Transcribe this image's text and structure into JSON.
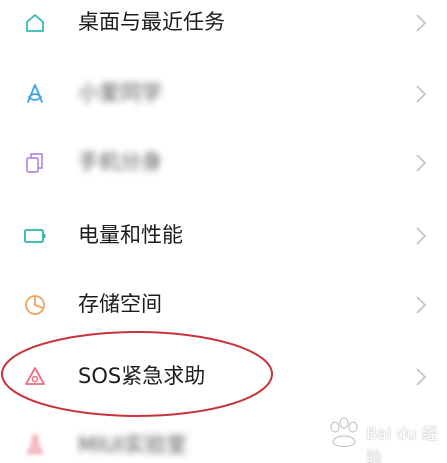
{
  "settings_list": {
    "items": [
      {
        "label": "桌面与最近任务",
        "icon": "home-icon",
        "icon_color": "#35b9b4"
      },
      {
        "label": "小爱同学",
        "icon": "xiaoai-icon",
        "icon_color": "#3aa6e6",
        "blurred": true
      },
      {
        "label": "手机分身",
        "icon": "dual-phone-icon",
        "icon_color": "#b48be0",
        "blurred": true
      },
      {
        "label": "电量和性能",
        "icon": "battery-icon",
        "icon_color": "#2fb5a8"
      },
      {
        "label": "存储空间",
        "icon": "storage-pie-icon",
        "icon_color": "#f0a25f"
      },
      {
        "label": "SOS紧急求助",
        "icon": "sos-alert-icon",
        "icon_color": "#ef6b7d"
      },
      {
        "label": "MIUI实验室",
        "icon": "lab-icon",
        "icon_color": "#f08a9a",
        "blurred": true
      }
    ]
  },
  "annotation": {
    "color": "#c8323a"
  },
  "watermark": {
    "text": "Bai du 经验"
  }
}
